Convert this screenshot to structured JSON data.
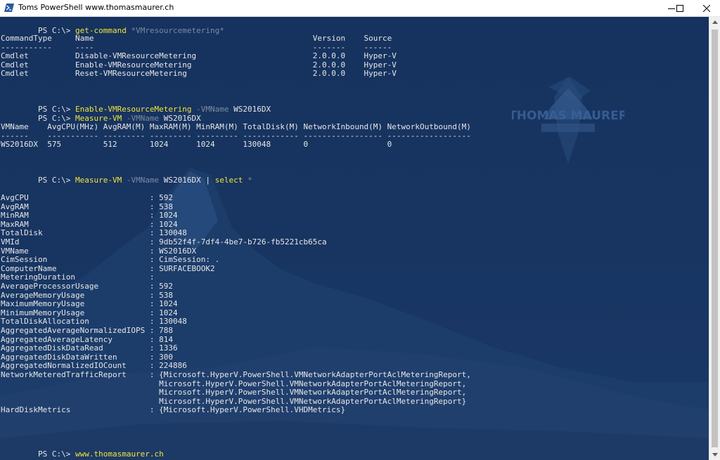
{
  "window": {
    "title": "Toms PowerShell www.thomasmaurer.ch"
  },
  "colors": {
    "console_bg": "#16325e",
    "command": "#f0e33c",
    "parameter": "#7c8aa0",
    "text": "#e6e6e6"
  },
  "watermark": {
    "line1": "THOMAS MAURER"
  },
  "terminal": {
    "cmd1": {
      "prompt": "PS C:\\> ",
      "command": "get-command",
      "arg": " *VMresourcemetering*"
    },
    "gc_header": "CommandType     Name                                               Version    Source",
    "gc_rule": "-----------     ----                                               -------    ------",
    "gc_rows": [
      "Cmdlet          Disable-VMResourceMetering                         2.0.0.0    Hyper-V",
      "Cmdlet          Enable-VMResourceMetering                          2.0.0.0    Hyper-V",
      "Cmdlet          Reset-VMResourceMetering                           2.0.0.0    Hyper-V"
    ],
    "cmd2": {
      "prompt": "PS C:\\> ",
      "command": "Enable-VMResourceMetering",
      "param": " -VMName",
      "arg": " WS2016DX"
    },
    "cmd3": {
      "prompt": "PS C:\\> ",
      "command": "Measure-VM",
      "param": " -VMName",
      "arg": " WS2016DX"
    },
    "mv_header": "VMName    AvgCPU(MHz) AvgRAM(M) MaxRAM(M) MinRAM(M) TotalDisk(M) NetworkInbound(M) NetworkOutbound(M)",
    "mv_rule": "------    ----------- --------- --------- --------- ------------ ----------------- ------------------",
    "mv_row": "WS2016DX  575         512       1024      1024      130048       0                 0",
    "cmd4": {
      "prompt": "PS C:\\> ",
      "command": "Measure-VM",
      "param": " -VMName",
      "arg": " WS2016DX",
      "pipe": " | ",
      "command2": "select",
      "arg2": " *"
    },
    "props": [
      "AvgCPU                          : 592",
      "AvgRAM                          : 538",
      "MinRAM                          : 1024",
      "MaxRAM                          : 1024",
      "TotalDisk                       : 130048",
      "VMId                            : 9db52f4f-7df4-4be7-b726-fb5221cb65ca",
      "VMName                          : WS2016DX",
      "CimSession                      : CimSession: .",
      "ComputerName                    : SURFACEBOOK2",
      "MeteringDuration                :",
      "AverageProcessorUsage           : 592",
      "AverageMemoryUsage              : 538",
      "MaximumMemoryUsage              : 1024",
      "MinimumMemoryUsage              : 1024",
      "TotalDiskAllocation             : 130048",
      "AggregatedAverageNormalizedIOPS : 788",
      "AggregatedAverageLatency        : 814",
      "AggregatedDiskDataRead          : 1336",
      "AggregatedDiskDataWritten       : 300",
      "AggregatedNormalizedIOCount     : 224886",
      "NetworkMeteredTrafficReport     : {Microsoft.HyperV.PowerShell.VMNetworkAdapterPortAclMeteringReport,",
      "                                  Microsoft.HyperV.PowerShell.VMNetworkAdapterPortAclMeteringReport,",
      "                                  Microsoft.HyperV.PowerShell.VMNetworkAdapterPortAclMeteringReport,",
      "                                  Microsoft.HyperV.PowerShell.VMNetworkAdapterPortAclMeteringReport}",
      "HardDiskMetrics                 : {Microsoft.HyperV.PowerShell.VHDMetrics}"
    ],
    "cmd5": {
      "prompt": "PS C:\\> ",
      "command": "www.thomasmaurer.ch"
    }
  }
}
